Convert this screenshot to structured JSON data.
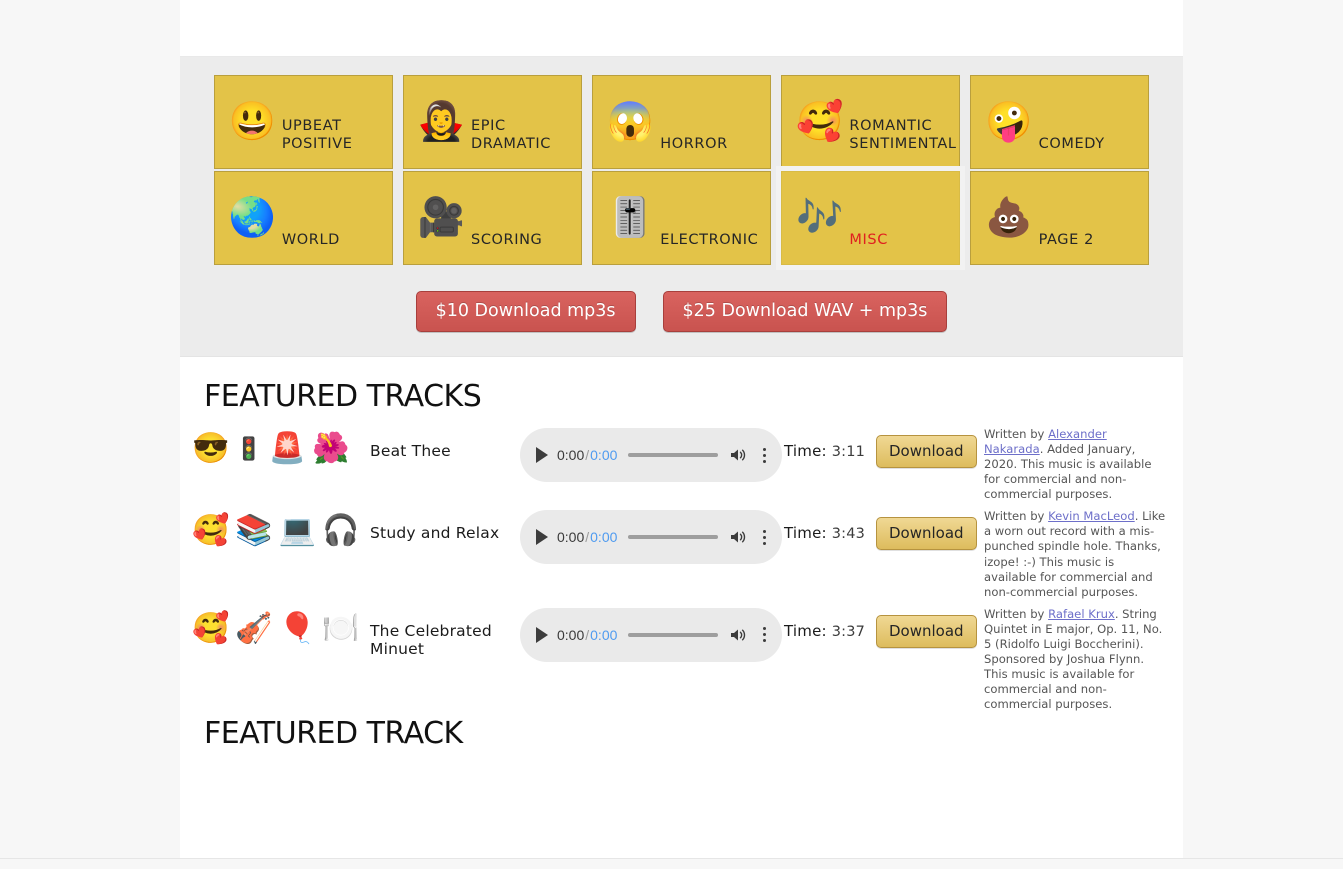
{
  "categories": {
    "tiles": [
      {
        "emoji": "😃",
        "icon_name": "grinning-face-icon",
        "label": "UPBEAT\nPOSITIVE",
        "active": false
      },
      {
        "emoji": "🧛‍♀️",
        "icon_name": "vampire-icon",
        "label": "EPIC\nDRAMATIC",
        "active": false
      },
      {
        "emoji": "😱",
        "icon_name": "screaming-face-icon",
        "label": "HORROR",
        "active": false
      },
      {
        "emoji": "🥰",
        "icon_name": "smiling-face-with-hearts-icon",
        "label": "ROMANTIC\nSENTIMENTAL",
        "active": false
      },
      {
        "emoji": "🤪",
        "icon_name": "zany-face-icon",
        "label": "COMEDY",
        "active": false
      },
      {
        "emoji": "🌏",
        "icon_name": "globe-icon",
        "label": "WORLD",
        "active": false
      },
      {
        "emoji": "🎥",
        "icon_name": "movie-camera-icon",
        "label": "SCORING",
        "active": false
      },
      {
        "emoji": "🎚️",
        "icon_name": "level-slider-icon",
        "label": "ELECTRONIC",
        "active": false
      },
      {
        "emoji": "🎶",
        "icon_name": "musical-notes-icon",
        "label": "MISC",
        "active": true
      },
      {
        "emoji": "💩",
        "icon_name": "pile-of-poo-icon",
        "label": "PAGE 2",
        "active": false
      }
    ],
    "active_label_color": "#e02020",
    "tile_color": "#e3c348"
  },
  "purchase": {
    "mp3_button": "$10 Download mp3s",
    "wav_button": "$25 Download WAV + mp3s",
    "button_color": "#cd5b57"
  },
  "featured_tracks": {
    "heading": "FEATURED TRACKS",
    "time_label": "Time:",
    "download_label": "Download",
    "player": {
      "current_time": "0:00",
      "separator": "/",
      "duration": "0:00",
      "play_icon": "play-icon",
      "volume_icon": "volume-icon",
      "menu_icon": "kebab-menu-icon"
    },
    "rows": [
      {
        "emojis": [
          "😎",
          "🚦",
          "🚨",
          "🌺"
        ],
        "emoji_names": [
          "smiling-face-with-sunglasses-icon",
          "vertical-traffic-light-icon",
          "police-car-light-icon",
          "hibiscus-icon"
        ],
        "title": "Beat Thee",
        "time": "3:11",
        "desc_prefix": "Written by ",
        "author": "Alexander Nakarada",
        "desc_suffix": ". Added January, 2020. This music is available for commercial and non-commercial purposes."
      },
      {
        "emojis": [
          "🥰",
          "📚",
          "💻",
          "🎧"
        ],
        "emoji_names": [
          "smiling-face-with-hearts-icon",
          "books-icon",
          "laptop-icon",
          "headphone-icon"
        ],
        "title": "Study and Relax",
        "time": "3:43",
        "desc_prefix": "Written by ",
        "author": "Kevin MacLeod",
        "desc_suffix": ". Like a worn out record with a mis-punched spindle hole. Thanks, izope! :-) This music is available for commercial and non-commercial purposes."
      },
      {
        "emojis": [
          "🥰",
          "🎻",
          "🎈",
          "🍽️"
        ],
        "emoji_names": [
          "smiling-face-with-hearts-icon",
          "violin-icon",
          "balloon-icon",
          "fork-and-knife-with-plate-icon"
        ],
        "title": "The Celebrated Minuet",
        "time": "3:37",
        "desc_prefix": "Written by ",
        "author": "Rafael Krux",
        "desc_suffix": ". String Quintet in E major, Op. 11, No. 5 (Ridolfo Luigi Boccherini). Sponsored by Joshua Flynn. This music is available for commercial and non-commercial purposes."
      }
    ]
  },
  "featured_track": {
    "heading": "FEATURED TRACK"
  }
}
